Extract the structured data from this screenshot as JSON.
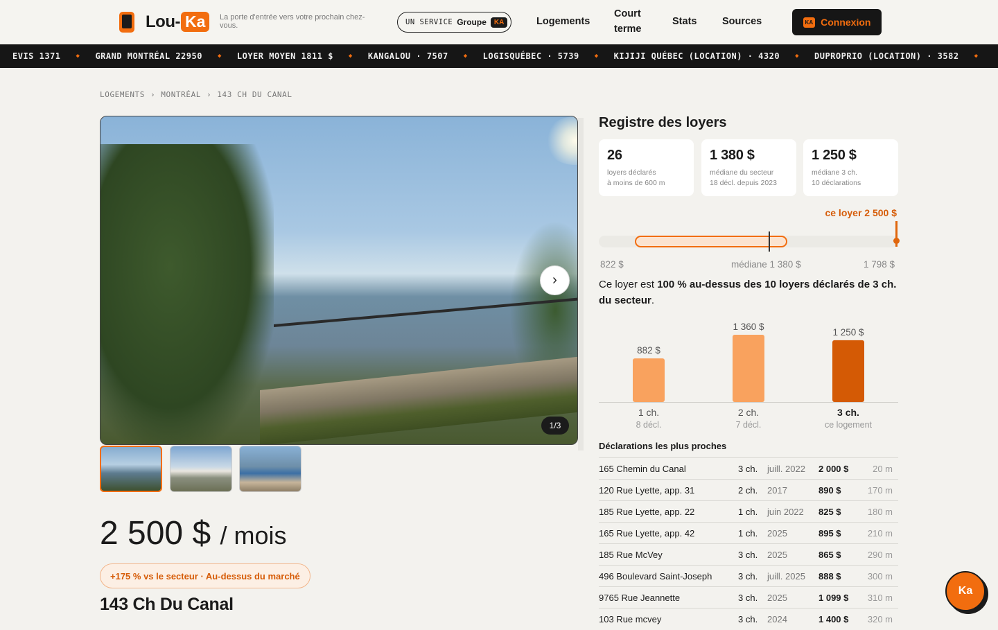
{
  "header": {
    "logo_prefix": "Lou-",
    "logo_ka": "Ka",
    "tagline": "La porte d'entrée vers votre prochain chez-vous.",
    "service_label": "UN SERVICE",
    "service_groupe": "Groupe",
    "service_ka": "KA",
    "nav": [
      "Logements",
      "Court terme",
      "Stats",
      "Sources"
    ],
    "connexion_ka": "KA",
    "connexion_label": "Connexion"
  },
  "ticker": [
    "EVIS 1371",
    "GRAND MONTRÉAL 22950",
    "LOYER MOYEN 1811 $",
    "KANGALOU · 7507",
    "LOGISQUÉBEC · 5739",
    "KIJIJI QUÉBEC (LOCATION) · 4320",
    "DUPROPRIO (LOCATION) · 3582"
  ],
  "breadcrumb": [
    "LOGEMENTS",
    "›",
    "MONTRÉAL",
    "›",
    "143 CH DU CANAL"
  ],
  "gallery": {
    "counter": "1/3",
    "next_glyph": "›"
  },
  "listing": {
    "price": "2 500 $",
    "price_unit": "/ mois",
    "market_badge": "+175 % vs le secteur · Au-dessus du marché",
    "address": "143 Ch Du Canal"
  },
  "registry": {
    "title": "Registre des loyers",
    "stats": [
      {
        "value": "26",
        "line1": "loyers déclarés",
        "line2": "à moins de 600 m"
      },
      {
        "value": "1 380 $",
        "line1": "médiane du secteur",
        "line2": "18 décl. depuis 2023"
      },
      {
        "value": "1 250 $",
        "line1": "médiane 3 ch.",
        "line2": "10 déclarations"
      }
    ],
    "this_rent_label": "ce loyer 2 500 $",
    "range": {
      "min_label": "822 $",
      "median_label": "médiane 1 380 $",
      "max_label": "1 798 $"
    },
    "summary_prefix": "Ce loyer est ",
    "summary_bold": "100 % au-dessus des 10 loyers déclarés de 3 ch. du secteur",
    "summary_suffix": "."
  },
  "chart_data": {
    "type": "bar",
    "categories": [
      "1 ch.",
      "2 ch.",
      "3 ch."
    ],
    "sublabels": [
      "8 décl.",
      "7 décl.",
      "ce logement"
    ],
    "values": [
      882,
      1360,
      1250
    ],
    "value_labels": [
      "882 $",
      "1 360 $",
      "1 250 $"
    ],
    "highlight_index": 2,
    "colors": {
      "normal": "#f9a25e",
      "highlight": "#d45a05"
    },
    "ylim": [
      0,
      1400
    ]
  },
  "declarations": {
    "title": "Déclarations les plus proches",
    "rows": [
      {
        "street": "165 Chemin du Canal",
        "rooms": "3 ch.",
        "date": "juill. 2022",
        "price": "2 000 $",
        "dist": "20 m"
      },
      {
        "street": "120 Rue Lyette, app. 31",
        "rooms": "2 ch.",
        "date": "2017",
        "price": "890 $",
        "dist": "170 m"
      },
      {
        "street": "185 Rue Lyette, app. 22",
        "rooms": "1 ch.",
        "date": "juin 2022",
        "price": "825 $",
        "dist": "180 m"
      },
      {
        "street": "165 Rue Lyette, app. 42",
        "rooms": "1 ch.",
        "date": "2025",
        "price": "895 $",
        "dist": "210 m"
      },
      {
        "street": "185 Rue McVey",
        "rooms": "3 ch.",
        "date": "2025",
        "price": "865 $",
        "dist": "290 m"
      },
      {
        "street": "496 Boulevard Saint-Joseph",
        "rooms": "3 ch.",
        "date": "juill. 2025",
        "price": "888 $",
        "dist": "300 m"
      },
      {
        "street": "9765 Rue Jeannette",
        "rooms": "3 ch.",
        "date": "2025",
        "price": "1 099 $",
        "dist": "310 m"
      },
      {
        "street": "103 Rue mcvey",
        "rooms": "3 ch.",
        "date": "2024",
        "price": "1 400 $",
        "dist": "320 m"
      }
    ]
  },
  "chat": {
    "label": "Ka"
  },
  "colors": {
    "accent": "#f26d0f",
    "dark": "#161616",
    "background": "#f3f2ee"
  }
}
